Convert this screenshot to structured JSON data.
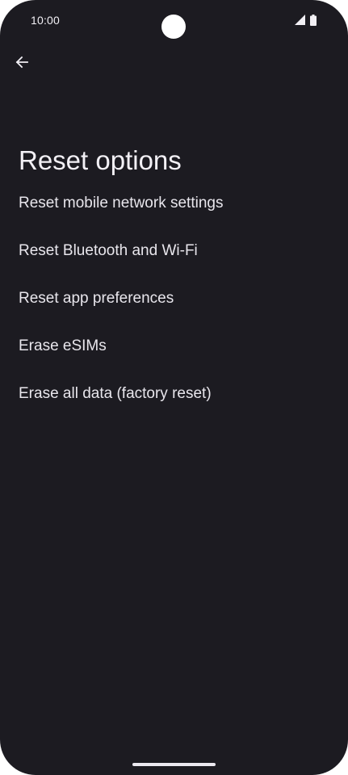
{
  "status_bar": {
    "time": "10:00",
    "icons": [
      "signal-icon",
      "battery-icon"
    ]
  },
  "toolbar": {
    "back_icon": "arrow-back-icon"
  },
  "page": {
    "title": "Reset options"
  },
  "options": [
    {
      "label": "Reset mobile network settings"
    },
    {
      "label": "Reset Bluetooth and Wi-Fi"
    },
    {
      "label": "Reset app preferences"
    },
    {
      "label": "Erase eSIMs"
    },
    {
      "label": "Erase all data (factory reset)"
    }
  ],
  "colors": {
    "background": "#1c1b21",
    "text": "#e8e6ec"
  }
}
